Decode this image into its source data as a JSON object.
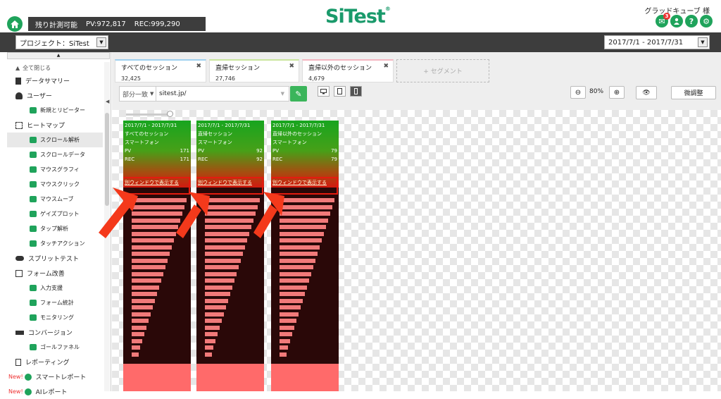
{
  "topbar": {
    "counter_label": "残り計測可能",
    "pv_text": "PV:972,817",
    "rec_text": "REC:999,290",
    "logo_text": "SiTest",
    "logo_reg": "®",
    "username": "グラッドキューブ 様",
    "notification_count": "3",
    "icons": [
      "home-icon",
      "notification-icon",
      "user-icon",
      "help-icon",
      "settings-icon"
    ],
    "brand_color": "#1fa35b"
  },
  "toolbar": {
    "project_select": "プロジェクト：SiTest",
    "date_range": "2017/7/1 - 2017/7/31"
  },
  "sidebar": {
    "collapse_all": "全て閉じる",
    "items": [
      {
        "label": "データサマリー",
        "level": "top"
      },
      {
        "label": "ユーザー",
        "level": "top"
      },
      {
        "label": "新規とリピーター",
        "level": "sub"
      },
      {
        "label": "ヒートマップ",
        "level": "top"
      },
      {
        "label": "スクロール解析",
        "level": "sub",
        "selected": true
      },
      {
        "label": "スクロールデータ",
        "level": "sub"
      },
      {
        "label": "マウスグラフィ",
        "level": "sub"
      },
      {
        "label": "マウスクリック",
        "level": "sub"
      },
      {
        "label": "マウスムーブ",
        "level": "sub"
      },
      {
        "label": "ゲイズプロット",
        "level": "sub"
      },
      {
        "label": "タップ解析",
        "level": "sub"
      },
      {
        "label": "タッチアクション",
        "level": "sub"
      },
      {
        "label": "スプリットテスト",
        "level": "top"
      },
      {
        "label": "フォーム改善",
        "level": "top"
      },
      {
        "label": "入力支援",
        "level": "sub"
      },
      {
        "label": "フォーム統計",
        "level": "sub"
      },
      {
        "label": "モニタリング",
        "level": "sub"
      },
      {
        "label": "コンバージョン",
        "level": "top"
      },
      {
        "label": "ゴールファネル",
        "level": "sub"
      },
      {
        "label": "レポーティング",
        "level": "top"
      },
      {
        "label": "スマートレポート",
        "level": "top",
        "new": "New!"
      },
      {
        "label": "AIレポート",
        "level": "top",
        "new": "New!"
      }
    ]
  },
  "segments": [
    {
      "label": "すべてのセッション",
      "value": "32,425",
      "color": "#9fd0ef"
    },
    {
      "label": "直帰セッション",
      "value": "27,746",
      "color": "#c9e59c"
    },
    {
      "label": "直帰以外のセッション",
      "value": "4,679",
      "color": "#f4b5c0"
    }
  ],
  "add_segment": "+ セグメント",
  "filter": {
    "match_type": "部分一致",
    "url": "sitest.jp/"
  },
  "zoom": {
    "level": "80%"
  },
  "fine_tune_label": "微調整",
  "cards": [
    {
      "period": "2017/7/1 - 2017/7/31",
      "segment": "すべてのセッション",
      "device": "スマートフォン",
      "pv_label": "PV",
      "pv": "171",
      "rec_label": "REC",
      "rec": "171",
      "open_link": "別ウィンドウで表示する"
    },
    {
      "period": "2017/7/1 - 2017/7/31",
      "segment": "直帰セッション",
      "device": "スマートフォン",
      "pv_label": "PV",
      "pv": "92",
      "rec_label": "REC",
      "rec": "92",
      "open_link": "別ウィンドウで表示する"
    },
    {
      "period": "2017/7/1 - 2017/7/31",
      "segment": "直帰以外のセッション",
      "device": "スマートフォン",
      "pv_label": "PV",
      "pv": "79",
      "rec_label": "REC",
      "rec": "79",
      "open_link": "別ウィンドウで表示する"
    }
  ],
  "annotation_color": "#e41b0f"
}
